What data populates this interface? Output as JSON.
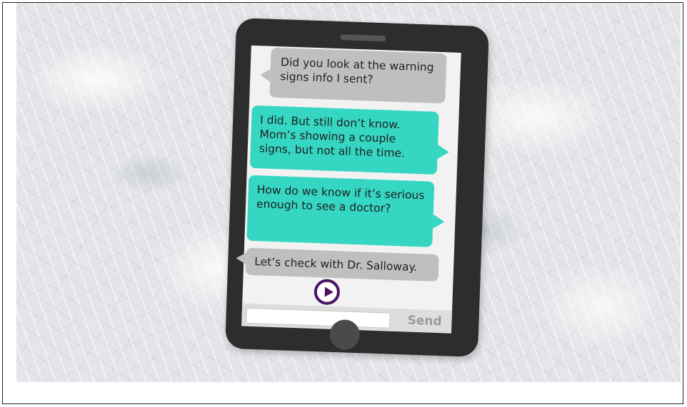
{
  "messages": [
    {
      "text": "Did you look at the warning signs info I sent?",
      "side": "incoming",
      "color": "#bfbfbf"
    },
    {
      "text": "I did. But still don’t know. Mom’s showing a couple signs, but not all the time.",
      "side": "outgoing",
      "color": "#35d6c2"
    },
    {
      "text": "How do we know if it’s serious enough to see a doctor?",
      "side": "outgoing",
      "color": "#35d6c2"
    },
    {
      "text": "Let’s check with Dr. Salloway.",
      "side": "incoming",
      "color": "#bfbfbf"
    }
  ],
  "composer": {
    "input_value": "",
    "send_label": "Send"
  },
  "icons": {
    "play": "play-icon"
  },
  "colors": {
    "phone_body": "#2d2d2d",
    "incoming_bubble": "#bfbfbf",
    "outgoing_bubble": "#35d6c2",
    "play_accent": "#4a1463",
    "background_marble": "#e3e5e8"
  }
}
